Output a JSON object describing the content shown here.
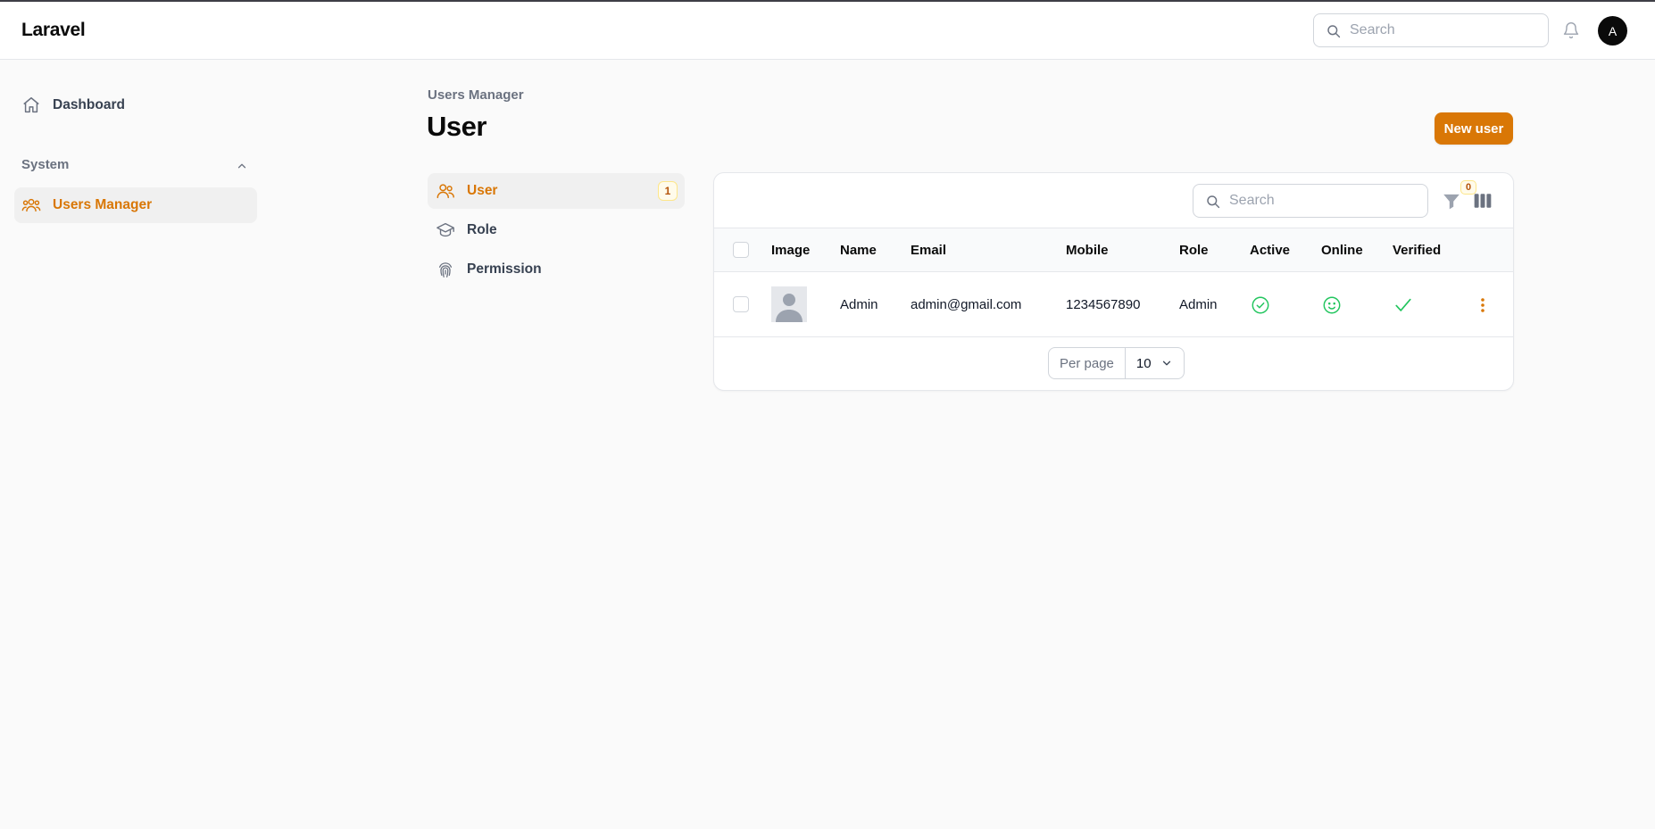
{
  "app": {
    "brand": "Laravel",
    "search_placeholder": "Search",
    "avatar_initial": "A"
  },
  "sidebar": {
    "dashboard_label": "Dashboard",
    "group_label": "System",
    "users_manager_label": "Users Manager"
  },
  "page": {
    "breadcrumb": "Users Manager",
    "title": "User",
    "new_button_label": "New user"
  },
  "subnav": {
    "items": [
      {
        "label": "User",
        "badge": "1"
      },
      {
        "label": "Role"
      },
      {
        "label": "Permission"
      }
    ]
  },
  "table": {
    "search_placeholder": "Search",
    "filter_count": "0",
    "headers": {
      "image": "Image",
      "name": "Name",
      "email": "Email",
      "mobile": "Mobile",
      "role": "Role",
      "active": "Active",
      "online": "Online",
      "verified": "Verified"
    },
    "rows": [
      {
        "name": "Admin",
        "email": "admin@gmail.com",
        "mobile": "1234567890",
        "role": "Admin",
        "active": true,
        "online": true,
        "verified": true
      }
    ],
    "pagination": {
      "per_page_label": "Per page",
      "per_page_value": "10"
    }
  },
  "colors": {
    "accent": "#d97706",
    "success": "#22c55e",
    "text": "#111827",
    "muted": "#6b7280"
  },
  "icons": [
    "search-icon",
    "bell-icon",
    "home-icon",
    "chevron-up-icon",
    "users-icon",
    "academic-cap-icon",
    "fingerprint-icon",
    "filter-icon",
    "columns-icon",
    "check-circle-icon",
    "smile-face-icon",
    "check-icon",
    "kebab-menu-icon",
    "chevron-down-icon"
  ]
}
